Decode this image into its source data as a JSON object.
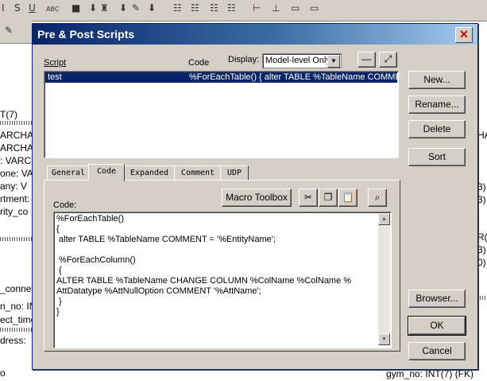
{
  "dialog": {
    "title": "Pre & Post Scripts",
    "labels": {
      "script": "Script",
      "code": "Code",
      "display": "Display:"
    },
    "display_value": "Model-level Only",
    "scripts": [
      {
        "name": "test",
        "code_preview": "%ForEachTable()  {  alter TABLE %TableName COMME"
      }
    ],
    "tabs": [
      "General",
      "Code",
      "Expanded",
      "Comment",
      "UDP"
    ],
    "active_tab": "Code",
    "code_label": "Code:",
    "macro_toolbox_label": "Macro Toolbox",
    "code_lines": [
      "%ForEachTable()",
      "{",
      " alter TABLE %TableName COMMENT = '%EntityName';",
      "",
      " %ForEachColumn()",
      " {",
      "ALTER TABLE %TableName CHANGE COLUMN %ColName %ColName %",
      "AttDatatype %AttNullOption COMMENT '%AttName';",
      " }",
      "}"
    ],
    "buttons": {
      "new": "New...",
      "rename": "Rename...",
      "delete": "Delete",
      "sort": "Sort",
      "browser": "Browser...",
      "ok": "OK",
      "cancel": "Cancel"
    }
  },
  "background": {
    "left_fragments": [
      "T(7)",
      "ARCHA",
      "ARCHA",
      ": VARC",
      "one: VA",
      "any: V",
      "rtment:",
      "rity_co",
      "_conne",
      "n_no: IN",
      "ect_time",
      "dress:",
      "o"
    ],
    "right_fragments": [
      "HA",
      "3)",
      "3)",
      "R(2",
      "3)",
      "0)"
    ],
    "bottom_right": "gym_no: INT(7) (FK)"
  }
}
